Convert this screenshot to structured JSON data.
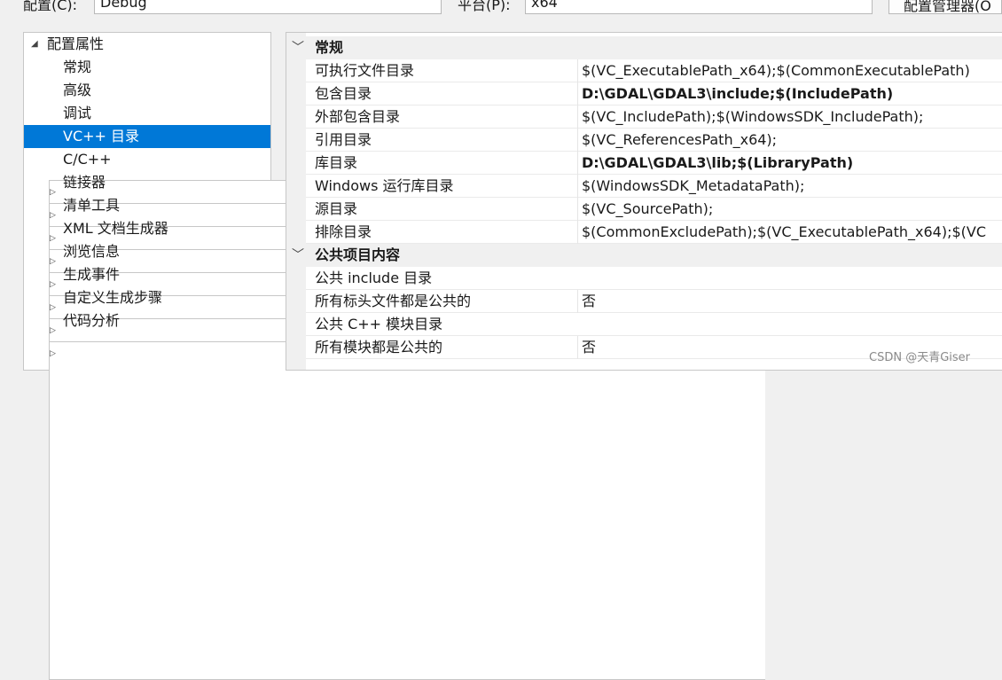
{
  "toolbar": {
    "config_label": "配置(C):",
    "config_value": "Debug",
    "platform_label": "平台(P):",
    "platform_value": "x64",
    "config_manager_button": "配置管理器(O"
  },
  "tree": {
    "root": "配置属性",
    "items": [
      {
        "label": "常规"
      },
      {
        "label": "高级"
      },
      {
        "label": "调试"
      },
      {
        "label": "VC++ 目录",
        "selected": true
      },
      {
        "label": "C/C++",
        "expandable": true
      },
      {
        "label": "链接器",
        "expandable": true
      },
      {
        "label": "清单工具",
        "expandable": true
      },
      {
        "label": "XML 文档生成器",
        "expandable": true
      },
      {
        "label": "浏览信息",
        "expandable": true
      },
      {
        "label": "生成事件",
        "expandable": true
      },
      {
        "label": "自定义生成步骤",
        "expandable": true
      },
      {
        "label": "代码分析",
        "expandable": true
      }
    ]
  },
  "properties": {
    "general": {
      "title": "常规",
      "rows": [
        {
          "name": "可执行文件目录",
          "value": "$(VC_ExecutablePath_x64);$(CommonExecutablePath)"
        },
        {
          "name": "包含目录",
          "value": "D:\\GDAL\\GDAL3\\include;$(IncludePath)",
          "bold": true,
          "highlighted": true
        },
        {
          "name": "外部包含目录",
          "value": "$(VC_IncludePath);$(WindowsSDK_IncludePath);"
        },
        {
          "name": "引用目录",
          "value": "$(VC_ReferencesPath_x64);"
        },
        {
          "name": "库目录",
          "value": "D:\\GDAL\\GDAL3\\lib;$(LibraryPath)",
          "bold": true,
          "highlighted": true
        },
        {
          "name": "Windows 运行库目录",
          "value": "$(WindowsSDK_MetadataPath);"
        },
        {
          "name": "源目录",
          "value": "$(VC_SourcePath);"
        },
        {
          "name": "排除目录",
          "value": "$(CommonExcludePath);$(VC_ExecutablePath_x64);$(VC"
        }
      ]
    },
    "public": {
      "title": "公共项目内容",
      "rows": [
        {
          "name": "公共 include 目录",
          "value": ""
        },
        {
          "name": "所有标头文件都是公共的",
          "value": "否"
        },
        {
          "name": "公共 C++ 模块目录",
          "value": ""
        },
        {
          "name": "所有模块都是公共的",
          "value": "否"
        }
      ]
    }
  },
  "icons": {
    "expanded": "triangle-down-icon",
    "collapsed": "triangle-right-icon",
    "category_chevron": "chevron-down-icon"
  },
  "colors": {
    "selection": "#0078d7",
    "highlight_box": "#d9262c"
  },
  "watermark": "CSDN @天青Giser"
}
